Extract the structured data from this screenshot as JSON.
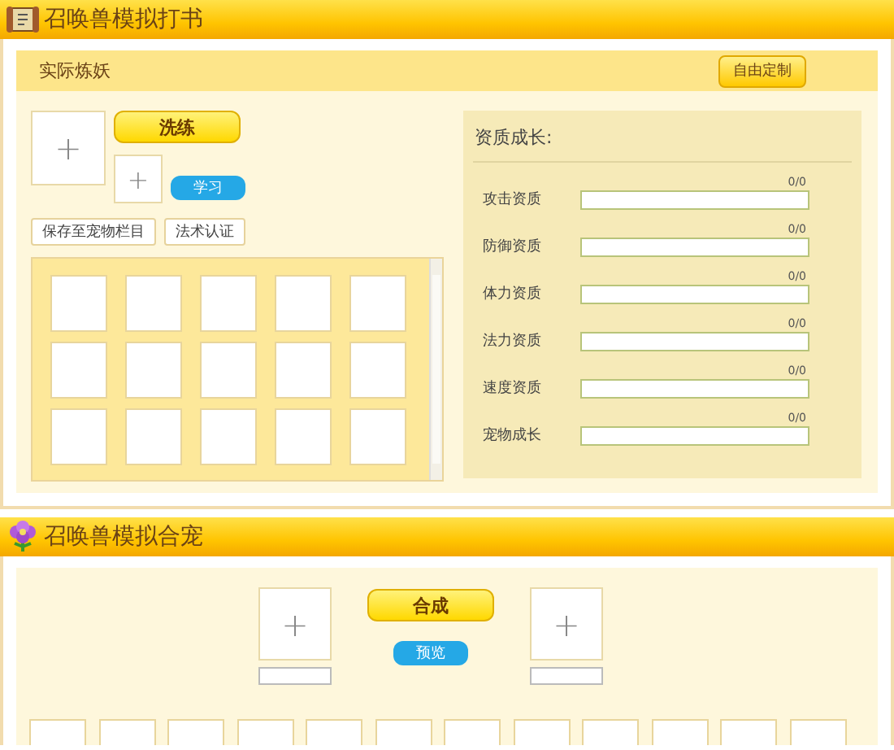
{
  "training": {
    "title": "召唤兽模拟打书",
    "subtitle": "实际炼妖",
    "custom_button": "自由定制",
    "main_slot": "+",
    "wash_button": "洗练",
    "skill_slot": "+",
    "learn_button": "学习",
    "actions": [
      "保存至宠物栏目",
      "法术认证"
    ],
    "slots": [
      {
        "kind": "empty"
      },
      {
        "kind": "empty"
      },
      {
        "kind": "empty"
      },
      {
        "kind": "empty"
      },
      {
        "kind": "empty"
      },
      {
        "kind": "empty"
      },
      {
        "kind": "empty"
      },
      {
        "kind": "empty"
      },
      {
        "kind": "empty"
      },
      {
        "kind": "empty"
      },
      {
        "kind": "empty"
      },
      {
        "kind": "empty"
      },
      {
        "kind": "empty"
      },
      {
        "kind": "empty"
      },
      {
        "kind": "empty"
      }
    ],
    "growth": {
      "title": "资质成长:",
      "stats": [
        {
          "label": "攻击资质",
          "reading": "0/0",
          "level": 0
        },
        {
          "label": "防御资质",
          "reading": "0/0",
          "level": 0
        },
        {
          "label": "体力资质",
          "reading": "0/0",
          "level": 0
        },
        {
          "label": "法力资质",
          "reading": "0/0",
          "level": 0
        },
        {
          "label": "速度资质",
          "reading": "0/0",
          "level": 0
        },
        {
          "label": "宠物成长",
          "reading": "0/0",
          "level": 0
        }
      ]
    }
  },
  "merge": {
    "title": "召唤兽模拟合宠",
    "left_slot": "+",
    "right_slot": "+",
    "merge_button": "合成",
    "preview_button": "预览",
    "slots": [
      {
        "kind": "empty"
      },
      {
        "kind": "empty"
      },
      {
        "kind": "empty"
      },
      {
        "kind": "empty"
      },
      {
        "kind": "empty"
      },
      {
        "kind": "empty"
      },
      {
        "kind": "empty"
      },
      {
        "kind": "empty"
      },
      {
        "kind": "empty"
      },
      {
        "kind": "empty"
      },
      {
        "kind": "empty"
      },
      {
        "kind": "empty"
      }
    ]
  }
}
